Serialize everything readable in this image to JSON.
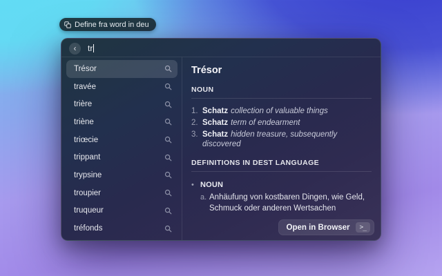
{
  "toast": {
    "label": "Define fra word in deu"
  },
  "search": {
    "back_icon": "‹",
    "value": "tr"
  },
  "list": {
    "items": [
      {
        "label": "Trésor",
        "selected": true
      },
      {
        "label": "travée",
        "selected": false
      },
      {
        "label": "trière",
        "selected": false
      },
      {
        "label": "triène",
        "selected": false
      },
      {
        "label": "triœcie",
        "selected": false
      },
      {
        "label": "trippant",
        "selected": false
      },
      {
        "label": "trypsine",
        "selected": false
      },
      {
        "label": "troupier",
        "selected": false
      },
      {
        "label": "truqueur",
        "selected": false
      },
      {
        "label": "tréfonds",
        "selected": false
      }
    ]
  },
  "detail": {
    "title": "Trésor",
    "pos_heading": "NOUN",
    "definitions": [
      {
        "num": "1.",
        "word": "Schatz",
        "text": "collection of valuable things"
      },
      {
        "num": "2.",
        "word": "Schatz",
        "text": "term of endearment"
      },
      {
        "num": "3.",
        "word": "Schatz",
        "text": "hidden treasure, subsequently discovered"
      }
    ],
    "dest_heading": "DEFINITIONS IN DEST LANGUAGE",
    "dest_bullet": "•",
    "dest_pos": "NOUN",
    "dest_item_letter": "a.",
    "dest_item_text": "Anhäufung von kostbaren Dingen, wie Geld, Schmuck oder anderen Wertsachen"
  },
  "footer": {
    "open_button": "Open in Browser",
    "shortcut": ">_"
  },
  "colors": {
    "bg_top_left": "#62dcf4",
    "bg_top_right": "#393ecf",
    "bg_bottom": "#b5a3f0",
    "window_top": "#1f3540",
    "window_bottom": "#3a3258",
    "selection": "rgba(255,255,255,0.13)"
  }
}
